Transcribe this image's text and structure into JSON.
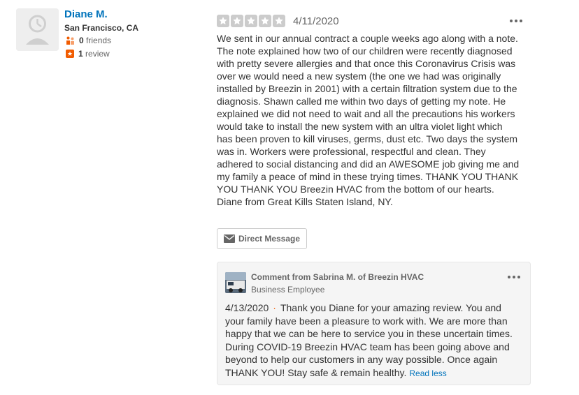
{
  "reviewer": {
    "name": "Diane M.",
    "location": "San Francisco, CA",
    "friends_count": "0",
    "friends_label": "friends",
    "reviews_count": "1",
    "reviews_label": "review",
    "avatar_icon": "default-user-avatar-icon"
  },
  "review": {
    "rating": 0,
    "rating_max": 5,
    "date": "4/11/2020",
    "text": "We sent in our annual contract a couple weeks ago along with a note.\n The note explained how two of our children were recently diagnosed\nwith pretty severe allergies and that once this Coronavirus Crisis was\nover we would need a new system (the one we had was originally\ninstalled by Breezin in 2001) with a certain filtration system due to the\ndiagnosis.  Shawn called me within two days of getting my note. He\nexplained we did not need to wait and all the precautions his workers\nwould take to install the new system with an ultra violet light which\nhas been proven to kill viruses, germs, dust etc. Two days the system\nwas in.  Workers were professional, respectful and clean.  They\nadhered to social distancing and did an AWESOME job giving me and\nmy family a peace of mind in these trying times.  THANK YOU THANK\nYOU THANK YOU Breezin HVAC from the bottom of our hearts.\n Diane from Great Kills Staten Island, NY.",
    "direct_message_label": "Direct Message"
  },
  "business_comment": {
    "title": "Comment from Sabrina M. of Breezin HVAC",
    "role": "Business Employee",
    "date": "4/13/2020",
    "separator": "·",
    "text": "Thank you Diane for your amazing review. You and\nyour family have been a pleasure to work with. We are more than\nhappy that we can be here to service you in these uncertain times.\nDuring COVID-19 Breezin HVAC team has been going above and\nbeyond to help our customers in any way possible. Once again\nTHANK YOU! Stay safe & remain healthy.",
    "read_less_label": "Read less"
  },
  "colors": {
    "link_blue": "#0073bb",
    "accent_orange": "#f15c00",
    "star_empty": "#cccccc",
    "comment_bg": "#f5f5f5"
  }
}
